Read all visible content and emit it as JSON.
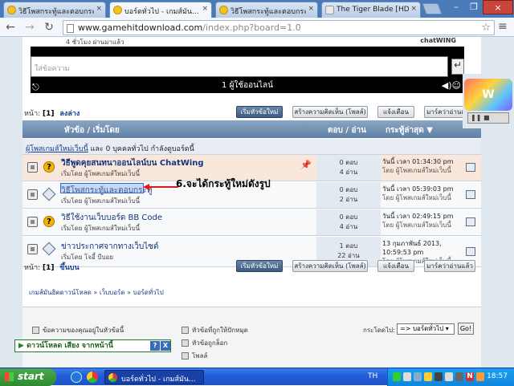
{
  "browser": {
    "tabs": [
      {
        "label": "วิธีโพสกระทู้และตอบกระ",
        "close": "×",
        "icon": "emoticon-icon"
      },
      {
        "label": "บอร์ดทั่วไป - เกมส์มัน...",
        "close": "×",
        "icon": "emoticon-icon",
        "active": true
      },
      {
        "label": "วิธีโพสกระทู้และตอบกระ",
        "close": "×",
        "icon": "emoticon-icon"
      },
      {
        "label": "The Tiger Blade [HD]|...",
        "close": "×",
        "icon": "page-icon"
      }
    ],
    "url_host": "www.gamehitdownload.com",
    "url_path": "/index.php?board=1.0",
    "window_buttons": [
      "–",
      "❐",
      "×"
    ],
    "nav": {
      "back": "←",
      "forward": "→",
      "reload": "↻",
      "star": "☆",
      "wrench": "≡"
    }
  },
  "chat": {
    "message_line": "4 ชั่วโมง ผ่านมาแล้ว",
    "brand": "chatWING",
    "input_placeholder": "ใส่ข้อความ",
    "send": "↵",
    "online": "1 ผู้ใช้ออนไลน์"
  },
  "forum": {
    "pages_label": "หน้า:",
    "page_current": "[1]",
    "go_down": "ลงล่าง",
    "go_up": "ขึ้นบน",
    "buttons": {
      "new_topic": "เริ่มหัวข้อใหม่",
      "new_poll": "สร้างความคิดเห็น (โพลล์)",
      "notify": "แจ้งเตือน",
      "mark_read": "มาร์คว่าอ่านแล้ว"
    },
    "columns": {
      "subject": "หัวข้อ / เริ่มโดย",
      "replies": "ตอบ / อ่าน",
      "last_post": "กระทู้ล่าสุด ▼"
    },
    "viewers": {
      "user": "ผู้โพสเกมส์ใหม่เว็บนี้",
      "text": " และ 0 บุคคลทั่วไป กำลังดูบอร์ดนี้"
    },
    "topics": [
      {
        "title": "วิธีพูดคุยสนทนาออนไลน์บน ChatWing",
        "by": "เริ่มโดย ผู้โพสเกมส์ใหม่เว็บนี้",
        "replies": "0 ตอบ",
        "views": "4 อ่าน",
        "last_date": "วันนี้ เวลา 01:34:30 pm",
        "last_by": "โดย ผู้โพสเกมส์ใหม่เว็บนี้",
        "pinned": true,
        "icon": "question"
      },
      {
        "title": "วิธีโพสกระทู้และตอบกระทู้",
        "by": "เริ่มโดย ผู้โพสเกมส์ใหม่เว็บนี้",
        "replies": "0 ตอบ",
        "views": "2 อ่าน",
        "last_date": "วันนี้ เวลา 05:39:03 pm",
        "last_by": "โดย ผู้โพสเกมส์ใหม่เว็บนี้",
        "pinned": false,
        "icon": "doc"
      },
      {
        "title": "วิธีใช้งานเว็บบอร์ด BB Code",
        "by": "เริ่มโดย ผู้โพสเกมส์ใหม่เว็บนี้",
        "replies": "0 ตอบ",
        "views": "4 อ่าน",
        "last_date": "วันนี้ เวลา 02:49:15 pm",
        "last_by": "โดย ผู้โพสเกมส์ใหม่เว็บนี้",
        "pinned": false,
        "icon": "question"
      },
      {
        "title": "ข่าวประกาศจากทางเว็บไซต์",
        "by": "เริ่มโดย โจอี้ บีบอย",
        "replies": "1 ตอบ",
        "views": "22 อ่าน",
        "last_date": "13 กุมภาพันธ์ 2013,",
        "last_time": "10:59:53 pm",
        "last_by": "โดย ผู้โพสเกมส์ใหม่เว็บนี้",
        "pinned": false,
        "icon": "doc"
      }
    ],
    "annotation": "6.จะได้กระทู้ใหม่ดังรูป",
    "breadcrumb": [
      "เกมส์มันฮิตดาวน์โหลด",
      "เว็บบอร์ด",
      "บอร์ดทั่วไป"
    ],
    "legend": [
      {
        "text": "ข้อความของคุณอยู่ในหัวข้อนี้"
      },
      {
        "text": "หัวข้อที่ถูกให้ปักหมุด"
      },
      {
        "text": "หัวข้อถูกล็อก"
      },
      {
        "text": "โพลล์"
      }
    ],
    "jump_label": "กระโดดไป:",
    "jump_value": "=> บอร์ดทั่วไป",
    "go": "Go!"
  },
  "download_bar": {
    "label": "ดาวน์โหลด เสียง จากหน้านี้",
    "help": "?",
    "close": "X"
  },
  "taskbar": {
    "start": "start",
    "item": "บอร์ดทั่วไป - เกมส์มัน...",
    "lang": "TH",
    "clock": "18:57"
  }
}
